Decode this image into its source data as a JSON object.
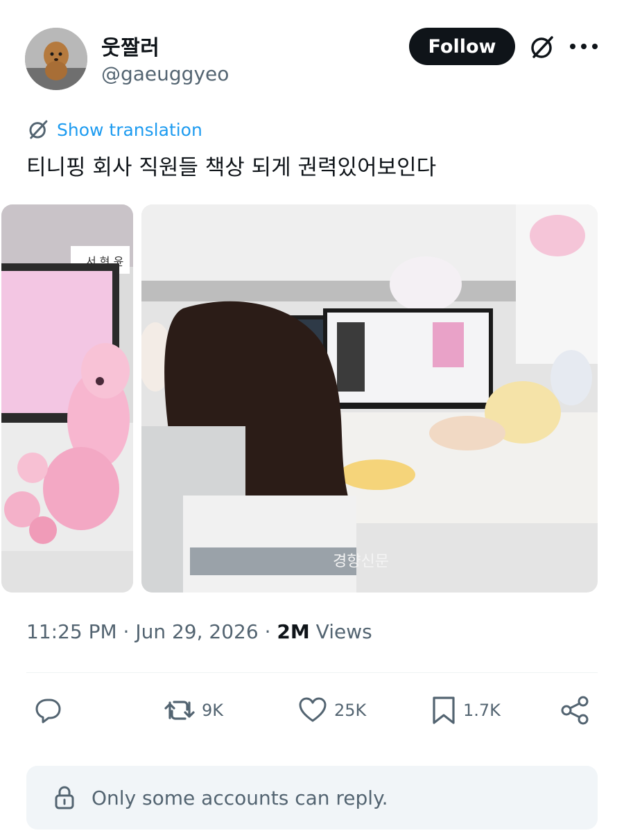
{
  "user": {
    "display_name": "웃짤러",
    "handle": "@gaeuggyeo"
  },
  "header": {
    "follow_label": "Follow",
    "grok_icon": "grok-icon",
    "more_icon": "more-icon"
  },
  "tweet": {
    "translate_label": "Show translation",
    "text": "티니핑 회사 직원들 책상 되게 권력있어보인다",
    "watermark": "경향신문",
    "name_plate": "서 현 윤"
  },
  "meta": {
    "time": "11:25 PM",
    "separator": " · ",
    "date": "Jun 29, 2026",
    "views_count": "2M",
    "views_label": " Views"
  },
  "actions": {
    "reply_count": "",
    "retweet_count": "9K",
    "like_count": "25K",
    "bookmark_count": "1.7K"
  },
  "reply_restriction": {
    "text": "Only some accounts can reply."
  },
  "colors": {
    "accent": "#1d9bf0",
    "text": "#0f1419",
    "secondary": "#536471",
    "follow_bg": "#0f1419"
  }
}
